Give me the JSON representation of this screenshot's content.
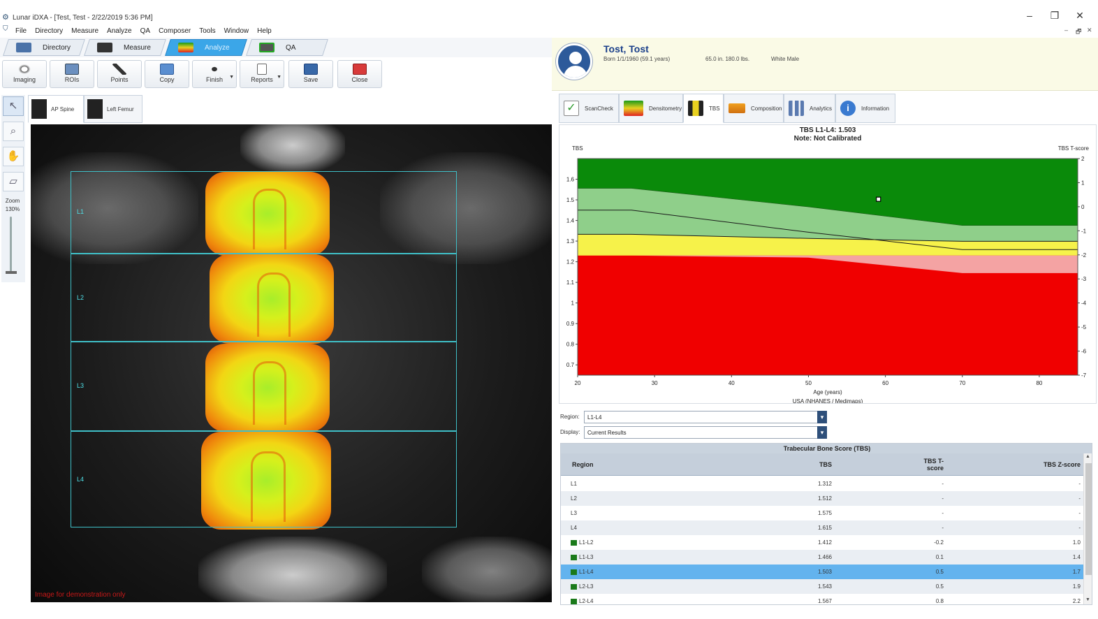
{
  "window": {
    "title": "Lunar iDXA - [Test, Test - 2/22/2019 5:36 PM]",
    "controls": [
      "–",
      "❐",
      "✕"
    ],
    "mdi_controls": [
      "–",
      "🗗",
      "✕"
    ]
  },
  "menu": [
    "File",
    "Directory",
    "Measure",
    "Analyze",
    "QA",
    "Composer",
    "Tools",
    "Window",
    "Help"
  ],
  "mode_tabs": [
    {
      "label": "Directory",
      "active": false
    },
    {
      "label": "Measure",
      "active": false
    },
    {
      "label": "Analyze",
      "active": true
    },
    {
      "label": "QA",
      "active": false
    }
  ],
  "toolbar": [
    "Imaging",
    "ROIs",
    "Points",
    "Copy",
    "Finish",
    "Reports",
    "Save",
    "Close"
  ],
  "left_tools": {
    "zoom_label": "Zoom",
    "zoom_value": "130%"
  },
  "image_tabs": [
    "AP Spine",
    "Left Femur"
  ],
  "scan": {
    "roi_labels": [
      "L1",
      "L2",
      "L3",
      "L4"
    ],
    "watermark": "Image for demonstration only"
  },
  "patient": {
    "name": "Tost, Tost",
    "born": "Born 1/1/1960  (59.1 years)",
    "body": "65.0 in.  180.0 lbs.",
    "ethnicity": "White Male"
  },
  "right_tabs": [
    "ScanCheck",
    "Densitometry",
    "TBS",
    "Composition",
    "Analytics",
    "Information"
  ],
  "right_tab_active": "TBS",
  "colors": {
    "accent": "#3ba6e8",
    "zone_green": "#0a8a0a",
    "zone_light_green": "#8fcf8a",
    "zone_yellow": "#f6f24a",
    "zone_pink": "#f4a3a3",
    "zone_red": "#f00000",
    "roi": "#3fc0c8"
  },
  "chart_data": {
    "type": "area",
    "title": "TBS L1-L4: 1.503",
    "subtitle": "Note: Not Calibrated",
    "ylabel": "TBS",
    "y2label": "TBS T-score",
    "xlabel": "Age (years)",
    "reference": "USA (NHANES / Medimaps)",
    "xlim": [
      20,
      85
    ],
    "ylim": [
      0.65,
      1.7
    ],
    "y2lim": [
      -7,
      2
    ],
    "x_ticks": [
      20,
      30,
      40,
      50,
      60,
      70,
      80
    ],
    "y_ticks": [
      0.7,
      0.8,
      0.9,
      1.0,
      1.1,
      1.2,
      1.3,
      1.4,
      1.5,
      1.6
    ],
    "y2_ticks": [
      2,
      1,
      0,
      -1,
      -2,
      -3,
      -4,
      -5,
      -6,
      -7
    ],
    "boundaries": {
      "x": [
        20,
        27,
        50,
        70,
        85
      ],
      "light_green_top": [
        1.556,
        1.556,
        1.466,
        1.376,
        1.376
      ],
      "mean": [
        1.45,
        1.45,
        1.343,
        1.259,
        1.259
      ],
      "dark_band_bottom": [
        1.333,
        1.333,
        1.313,
        1.299,
        1.299
      ],
      "yellow_bottom": [
        1.23,
        1.23,
        1.23,
        1.23,
        1.23
      ],
      "pink_bottom": [
        1.23,
        1.23,
        1.22,
        1.145,
        1.145
      ]
    },
    "marker": {
      "x": 59.1,
      "y": 1.503
    }
  },
  "form": {
    "region_label": "Region:",
    "region_value": "L1-L4",
    "display_label": "Display:",
    "display_value": "Current Results"
  },
  "table": {
    "title": "Trabecular Bone Score (TBS)",
    "headers": [
      "Region",
      "TBS",
      "TBS T-score",
      "TBS Z-score"
    ],
    "rows": [
      {
        "region": "L1",
        "tbs": "1.312",
        "t": "-",
        "z": "-",
        "group": false
      },
      {
        "region": "L2",
        "tbs": "1.512",
        "t": "-",
        "z": "-",
        "group": false
      },
      {
        "region": "L3",
        "tbs": "1.575",
        "t": "-",
        "z": "-",
        "group": false
      },
      {
        "region": "L4",
        "tbs": "1.615",
        "t": "-",
        "z": "-",
        "group": false
      },
      {
        "region": "L1-L2",
        "tbs": "1.412",
        "t": "-0.2",
        "z": "1.0",
        "group": true
      },
      {
        "region": "L1-L3",
        "tbs": "1.466",
        "t": "0.1",
        "z": "1.4",
        "group": true
      },
      {
        "region": "L1-L4",
        "tbs": "1.503",
        "t": "0.5",
        "z": "1.7",
        "group": true
      },
      {
        "region": "L2-L3",
        "tbs": "1.543",
        "t": "0.5",
        "z": "1.9",
        "group": true
      },
      {
        "region": "L2-L4",
        "tbs": "1.567",
        "t": "0.8",
        "z": "2.2",
        "group": true
      }
    ],
    "selected_row": "L1-L4"
  }
}
